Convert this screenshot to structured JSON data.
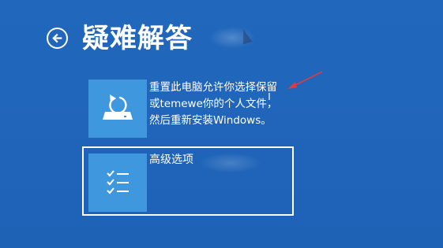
{
  "header": {
    "title": "疑难解答"
  },
  "options": [
    {
      "id": "reset",
      "icon": "reset-pc-icon",
      "lines": [
        "重置此电脑允许你选择保留",
        "或temewe你的个人文件，",
        "然后重新安装Windows。"
      ]
    },
    {
      "id": "advanced",
      "icon": "checklist-icon",
      "label": "高级选项"
    }
  ],
  "colors": {
    "background": "#1f63b8",
    "tile": "#3f98de",
    "text": "#ffffff",
    "arrow": "#e23b3b"
  }
}
